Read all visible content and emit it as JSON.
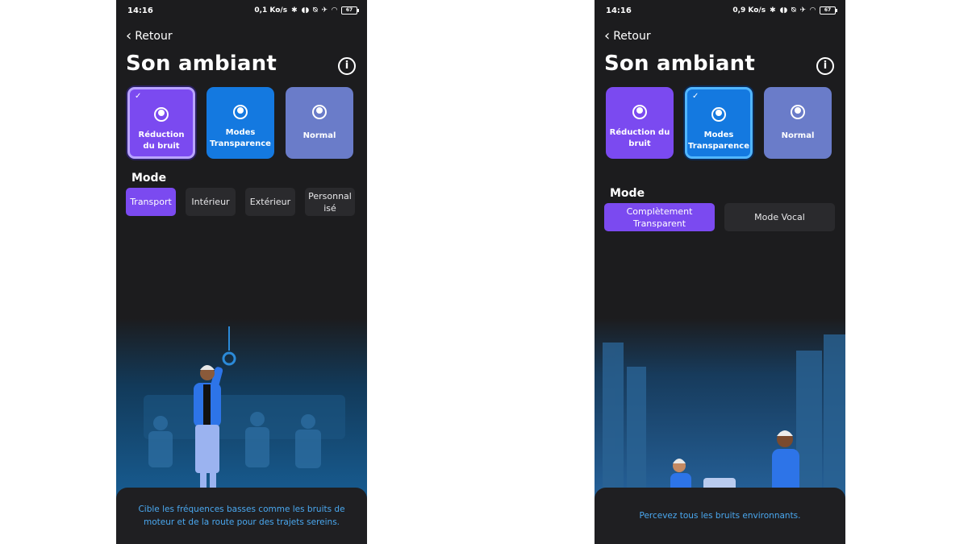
{
  "screens": [
    {
      "status": {
        "time": "14:16",
        "speed": "0,1 Ko/s",
        "battery": "67"
      },
      "back_label": "Retour",
      "title": "Son ambiant",
      "cards": [
        {
          "label": "Réduction du bruit",
          "selected": true
        },
        {
          "label": "Modes Transparence",
          "selected": false
        },
        {
          "label": "Normal",
          "selected": false
        }
      ],
      "mode_title": "Mode",
      "modes": [
        "Transport",
        "Intérieur",
        "Extérieur",
        "Personnalisé"
      ],
      "active_mode": "Transport",
      "description": "Cible les fréquences basses comme les bruits de moteur et de la route pour des trajets sereins."
    },
    {
      "status": {
        "time": "14:16",
        "speed": "0,9 Ko/s",
        "battery": "67"
      },
      "back_label": "Retour",
      "title": "Son ambiant",
      "cards": [
        {
          "label": "Réduction du bruit",
          "selected": false
        },
        {
          "label": "Modes Transparence",
          "selected": true
        },
        {
          "label": "Normal",
          "selected": false
        }
      ],
      "mode_title": "Mode",
      "modes": [
        "Complètement Transparent",
        "Mode Vocal"
      ],
      "active_mode": "Complètement Transparent",
      "description": "Percevez tous les bruits environnants."
    }
  ],
  "icons": {
    "back": "chevron-left-icon",
    "info": "info-icon",
    "check": "check-icon",
    "mode": "listening-person-icon"
  },
  "colors": {
    "background": "#1c1c1e",
    "purple": "#7b4af0",
    "blue": "#1479e0",
    "slate": "#6a7cc9",
    "desc_text": "#4aa8f0"
  }
}
